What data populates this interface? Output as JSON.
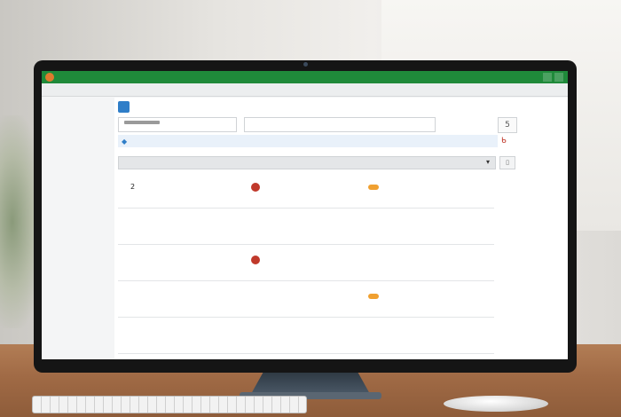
{
  "app": {
    "title": "",
    "accent": "#1f8a3a"
  },
  "toolbar": {
    "text": ""
  },
  "header": {
    "brand": "",
    "right_hint": "",
    "brand_icon": "app-logo-icon"
  },
  "search": {
    "field_b_text": "",
    "button_label": "5"
  },
  "notice": {
    "text": "",
    "right_symbol": "ᑲ"
  },
  "grid": {
    "toolbar_text": ""
  },
  "rows": [
    {
      "a": "2",
      "a_sub": "",
      "b": "",
      "c": "",
      "b_logo": "#c0392b",
      "c_badge": "#f0a030"
    },
    {
      "a": "",
      "a_sub": "",
      "b": "",
      "c": "",
      "b_logo": "",
      "c_badge": ""
    },
    {
      "a": "",
      "a_sub": "",
      "b": "",
      "c": "",
      "b_logo": "#c0392b",
      "c_badge": ""
    },
    {
      "a": "",
      "a_sub": "",
      "b": "",
      "c": "",
      "b_logo": "",
      "c_badge": "#f0a030"
    },
    {
      "a": "",
      "a_sub": "",
      "b": "",
      "c": "",
      "b_logo": "",
      "c_badge": ""
    }
  ]
}
